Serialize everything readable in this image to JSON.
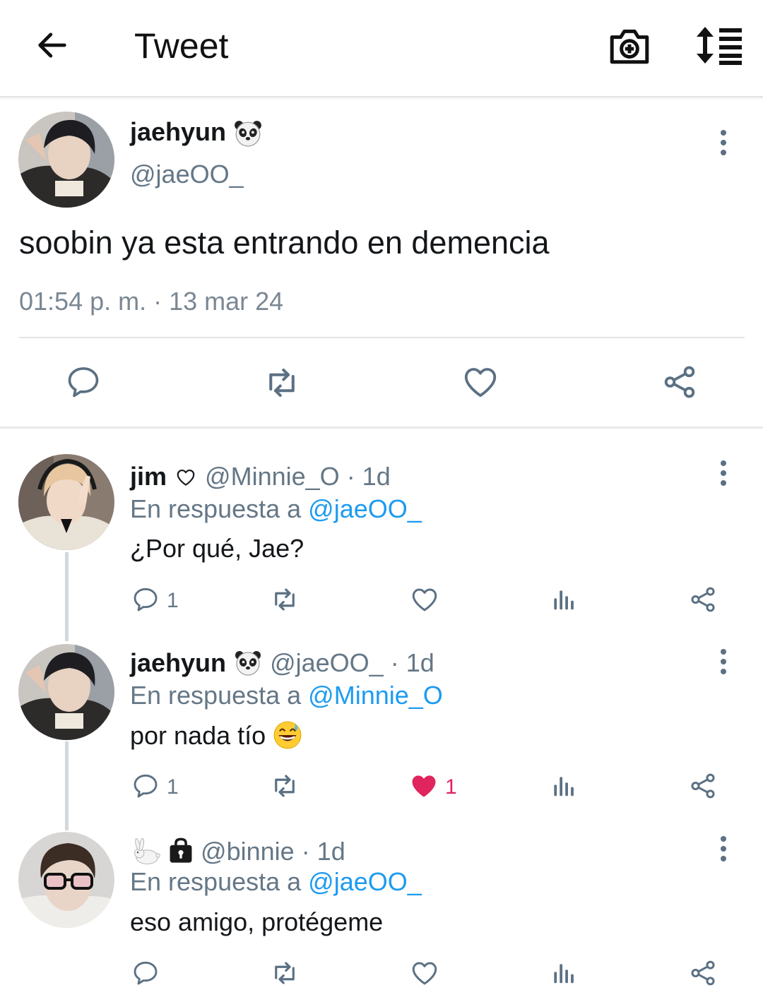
{
  "header": {
    "title": "Tweet"
  },
  "tweet": {
    "name": "jaehyun",
    "handle": "@jaeOO_",
    "text": "soobin ya esta entrando en demencia",
    "timestamp": "01:54 p. m. · 13 mar 24"
  },
  "replies": [
    {
      "name": "jim",
      "handle": "@Minnie_O",
      "age": "· 1d",
      "reply_prefix": "En respuesta a",
      "reply_to": "@jaeOO_",
      "text": "¿Por qué, Jae?",
      "reply_count": "1",
      "like_count": "",
      "liked": false
    },
    {
      "name": "jaehyun",
      "handle": "@jaeOO_",
      "age": "· 1d",
      "reply_prefix": "En respuesta a",
      "reply_to": "@Minnie_O",
      "text": "por nada tío",
      "reply_count": "1",
      "like_count": "1",
      "liked": true
    },
    {
      "name": "",
      "handle": "@binnie",
      "age": "· 1d",
      "reply_prefix": "En respuesta a",
      "reply_to": "@jaeOO_",
      "text": "eso amigo, protégeme",
      "reply_count": "",
      "like_count": "",
      "liked": false
    }
  ],
  "colors": {
    "accent": "#1d9bf0",
    "icon": "#5b7083",
    "like": "#e0245e"
  }
}
